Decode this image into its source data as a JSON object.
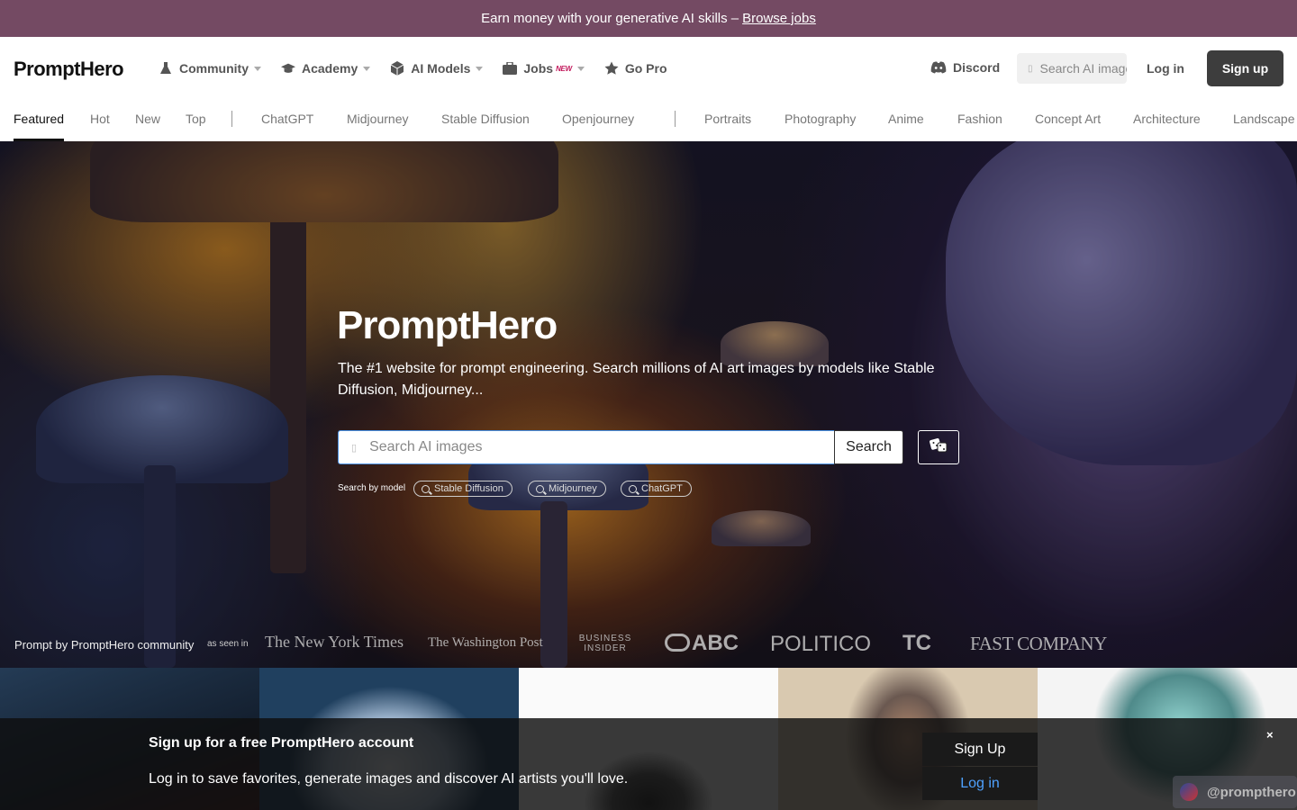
{
  "banner": {
    "text": "Earn money with your generative AI skills –",
    "link": "Browse jobs"
  },
  "header": {
    "logo": "PromptHero",
    "nav": [
      {
        "label": "Community",
        "icon": "flask-icon"
      },
      {
        "label": "Academy",
        "icon": "graduation-cap-icon"
      },
      {
        "label": "AI Models",
        "icon": "cube-icon"
      },
      {
        "label": "Jobs",
        "icon": "briefcase-icon",
        "badge": "NEW"
      },
      {
        "label": "Go Pro",
        "icon": "star-icon"
      }
    ],
    "discord": "Discord",
    "search_placeholder": "Search AI images",
    "login": "Log in",
    "signup": "Sign up"
  },
  "tabs": {
    "primary": [
      "Featured",
      "Hot",
      "New",
      "Top"
    ],
    "models": [
      "ChatGPT",
      "Midjourney",
      "Stable Diffusion",
      "Openjourney"
    ],
    "categories": [
      "Portraits",
      "Photography",
      "Anime",
      "Fashion",
      "Concept Art",
      "Architecture",
      "Landscape"
    ]
  },
  "hero": {
    "title": "PromptHero",
    "description": "The #1 website for prompt engineering. Search millions of AI art images by models like Stable Diffusion, Midjourney...",
    "search_placeholder": "Search AI images",
    "search_button": "Search",
    "by_model_label": "Search by model",
    "models": [
      "Stable Diffusion",
      "Midjourney",
      "ChatGPT"
    ],
    "credit": "Prompt by PromptHero community",
    "seen_in": "as seen in",
    "press": [
      "The New York Times",
      "The Washington Post",
      "BUSINESS INSIDER",
      "ABC",
      "POLITICO",
      "TC",
      "FAST COMPANY"
    ]
  },
  "popup": {
    "title": "Sign up for a free PromptHero account",
    "text": "Log in to save favorites, generate images and discover AI artists you'll love.",
    "signup": "Sign Up",
    "login": "Log in",
    "close": "×"
  },
  "handle": "@prompthero"
}
